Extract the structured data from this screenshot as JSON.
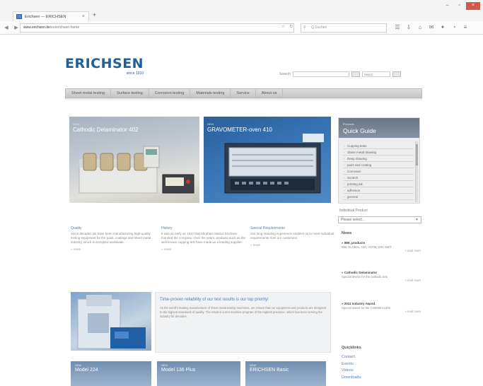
{
  "browser": {
    "tab_title": "Erichsen — ERICHSEN",
    "tab_close": "×",
    "new_tab": "+",
    "url_host": "www.erichsen.de",
    "url_path": "/en/erichsen-home",
    "search_placeholder": "Q Suchen",
    "controls": [
      "–",
      "▫",
      "×"
    ]
  },
  "site": {
    "logo_text": "ERICHSEN",
    "logo_since": "since 1910",
    "search_label": "Search",
    "search_placeholder": "",
    "search_select": "Select",
    "nav": [
      "Sheet metal testing",
      "Surface testing",
      "Corrosion testing",
      "Materials testing",
      "Service",
      "About us"
    ],
    "hero1": {
      "label": "NEW",
      "title": "Cathodic Delaminator 402"
    },
    "hero2": {
      "label": "NEW",
      "title": "GRAVOMETER-oven 410"
    },
    "quick_search": {
      "label": "Products",
      "title": "Quick Guide",
      "items": [
        "Cupping tests",
        "Sheet metal drawing",
        "Deep drawing",
        "paint and coating",
        "Corrosion",
        "Scratch",
        "printing ink",
        "adhesion",
        "general"
      ]
    },
    "dropdown_label": "Individual Product",
    "dropdown_value": "Please select...",
    "news_title": "News",
    "news": [
      {
        "h": "» IBB, products",
        "t": "IBB, GLOBAL, ISO, ASTM, DIN, GB/T",
        "more": "» read more"
      },
      {
        "h": "» Cathodic Delaminator",
        "t": "Special device for the cathodic test",
        "more": "» read more"
      },
      {
        "h": "» 2011 industry Award",
        "t": "Special award for the CHEMIKALIEN",
        "more": "» read more"
      }
    ],
    "quick_links_title": "Quicklinks",
    "quick_links": [
      "Contact",
      "Events",
      "Videos",
      "Downloads"
    ],
    "columns": [
      {
        "h": "Quality",
        "t": "Since decades we have been manufacturing high-quality testing equipment for the paint, coatings and sheet metal industry, which is accepted worldwide.",
        "more": "» more"
      },
      {
        "h": "History",
        "t": "It was as early as 1910 that Abraham Marius Erichsen founded the company. Over the years, products such as the well-known cupping test have made us a leading supplier.",
        "more": "» more"
      },
      {
        "h": "Special Requirements",
        "t": "Our long-standing experience enables us to meet individual requirements from our customers.",
        "more": "» more"
      }
    ],
    "feature": {
      "h": "Time-proven reliability of our test results is our top priority!",
      "p": "As the world's leading manufacturer of sheet metal testing machines, we ensure that our equipment and products are designed to the highest standards of quality. The result is a test machine program of the highest precision, which has been serving the industry for decades."
    },
    "products": [
      {
        "label": "NEW",
        "title": "Model 224"
      },
      {
        "label": "NEW",
        "title": "Model 136 Plus"
      },
      {
        "label": "NEW",
        "title": "ERICHSEN Basic"
      }
    ]
  }
}
